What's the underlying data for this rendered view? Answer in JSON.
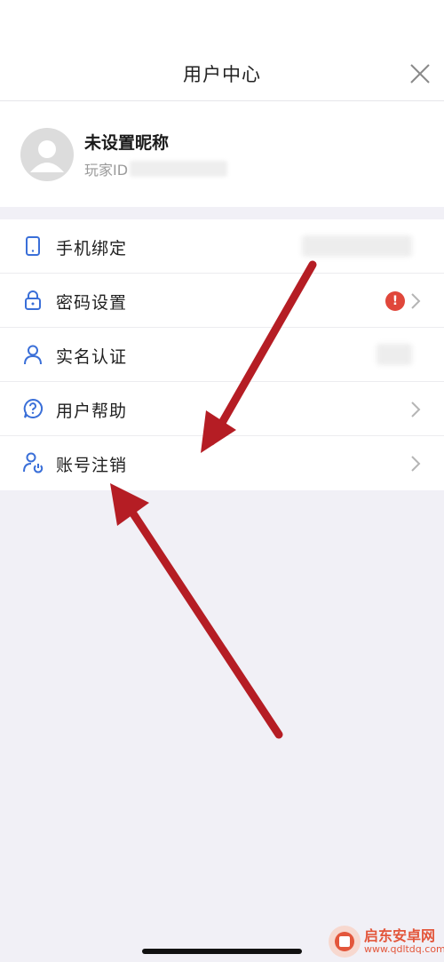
{
  "header": {
    "title": "用户中心"
  },
  "profile": {
    "nickname": "未设置昵称",
    "player_id_label": "玩家ID"
  },
  "menu": {
    "items": [
      {
        "label": "手机绑定"
      },
      {
        "label": "密码设置",
        "badge": "!"
      },
      {
        "label": "实名认证"
      },
      {
        "label": "用户帮助"
      },
      {
        "label": "账号注销"
      }
    ]
  },
  "watermark": {
    "name": "启东安卓网",
    "url": "www.qdltdq.com"
  },
  "colors": {
    "accent": "#3a6fd8",
    "alert": "#e0473b",
    "arrow": "#b51d24",
    "page_bg": "#f1f0f6"
  }
}
